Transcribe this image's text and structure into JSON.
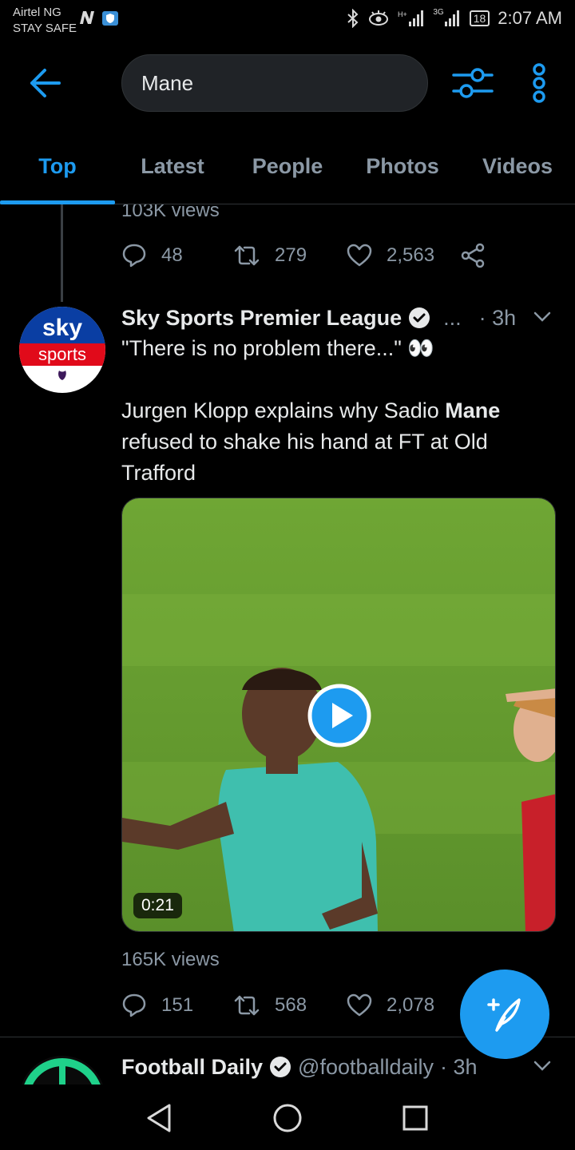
{
  "status_bar": {
    "carrier_line1": "Airtel NG",
    "carrier_line2": "STAY SAFE",
    "battery": "18",
    "time": "2:07 AM",
    "network_label": "3G"
  },
  "search": {
    "query": "Mane"
  },
  "tabs": [
    {
      "label": "Top",
      "active": true
    },
    {
      "label": "Latest"
    },
    {
      "label": "People"
    },
    {
      "label": "Photos"
    },
    {
      "label": "Videos"
    }
  ],
  "prev_tweet": {
    "views": "103K views",
    "replies": "48",
    "retweets": "279",
    "likes": "2,563"
  },
  "tweet": {
    "author": "Sky Sports Premier League",
    "ellipsis": "...",
    "time": "· 3h",
    "line1": "\"There is no problem there...\" 👀",
    "body_before": "Jurgen Klopp explains why Sadio ",
    "body_bold": "Mane",
    "body_after": " refused to shake his hand at FT at Old Trafford",
    "avatar_text_top": "sky",
    "avatar_text_bottom": "sports",
    "video_duration": "0:21",
    "views": "165K views",
    "replies": "151",
    "retweets": "568",
    "likes": "2,078"
  },
  "next_tweet": {
    "author": "Football Daily",
    "handle": "@footballdaily",
    "time": "· 3h"
  },
  "colors": {
    "accent": "#1d9bf0",
    "muted": "#8b98a5",
    "background": "#000000"
  }
}
